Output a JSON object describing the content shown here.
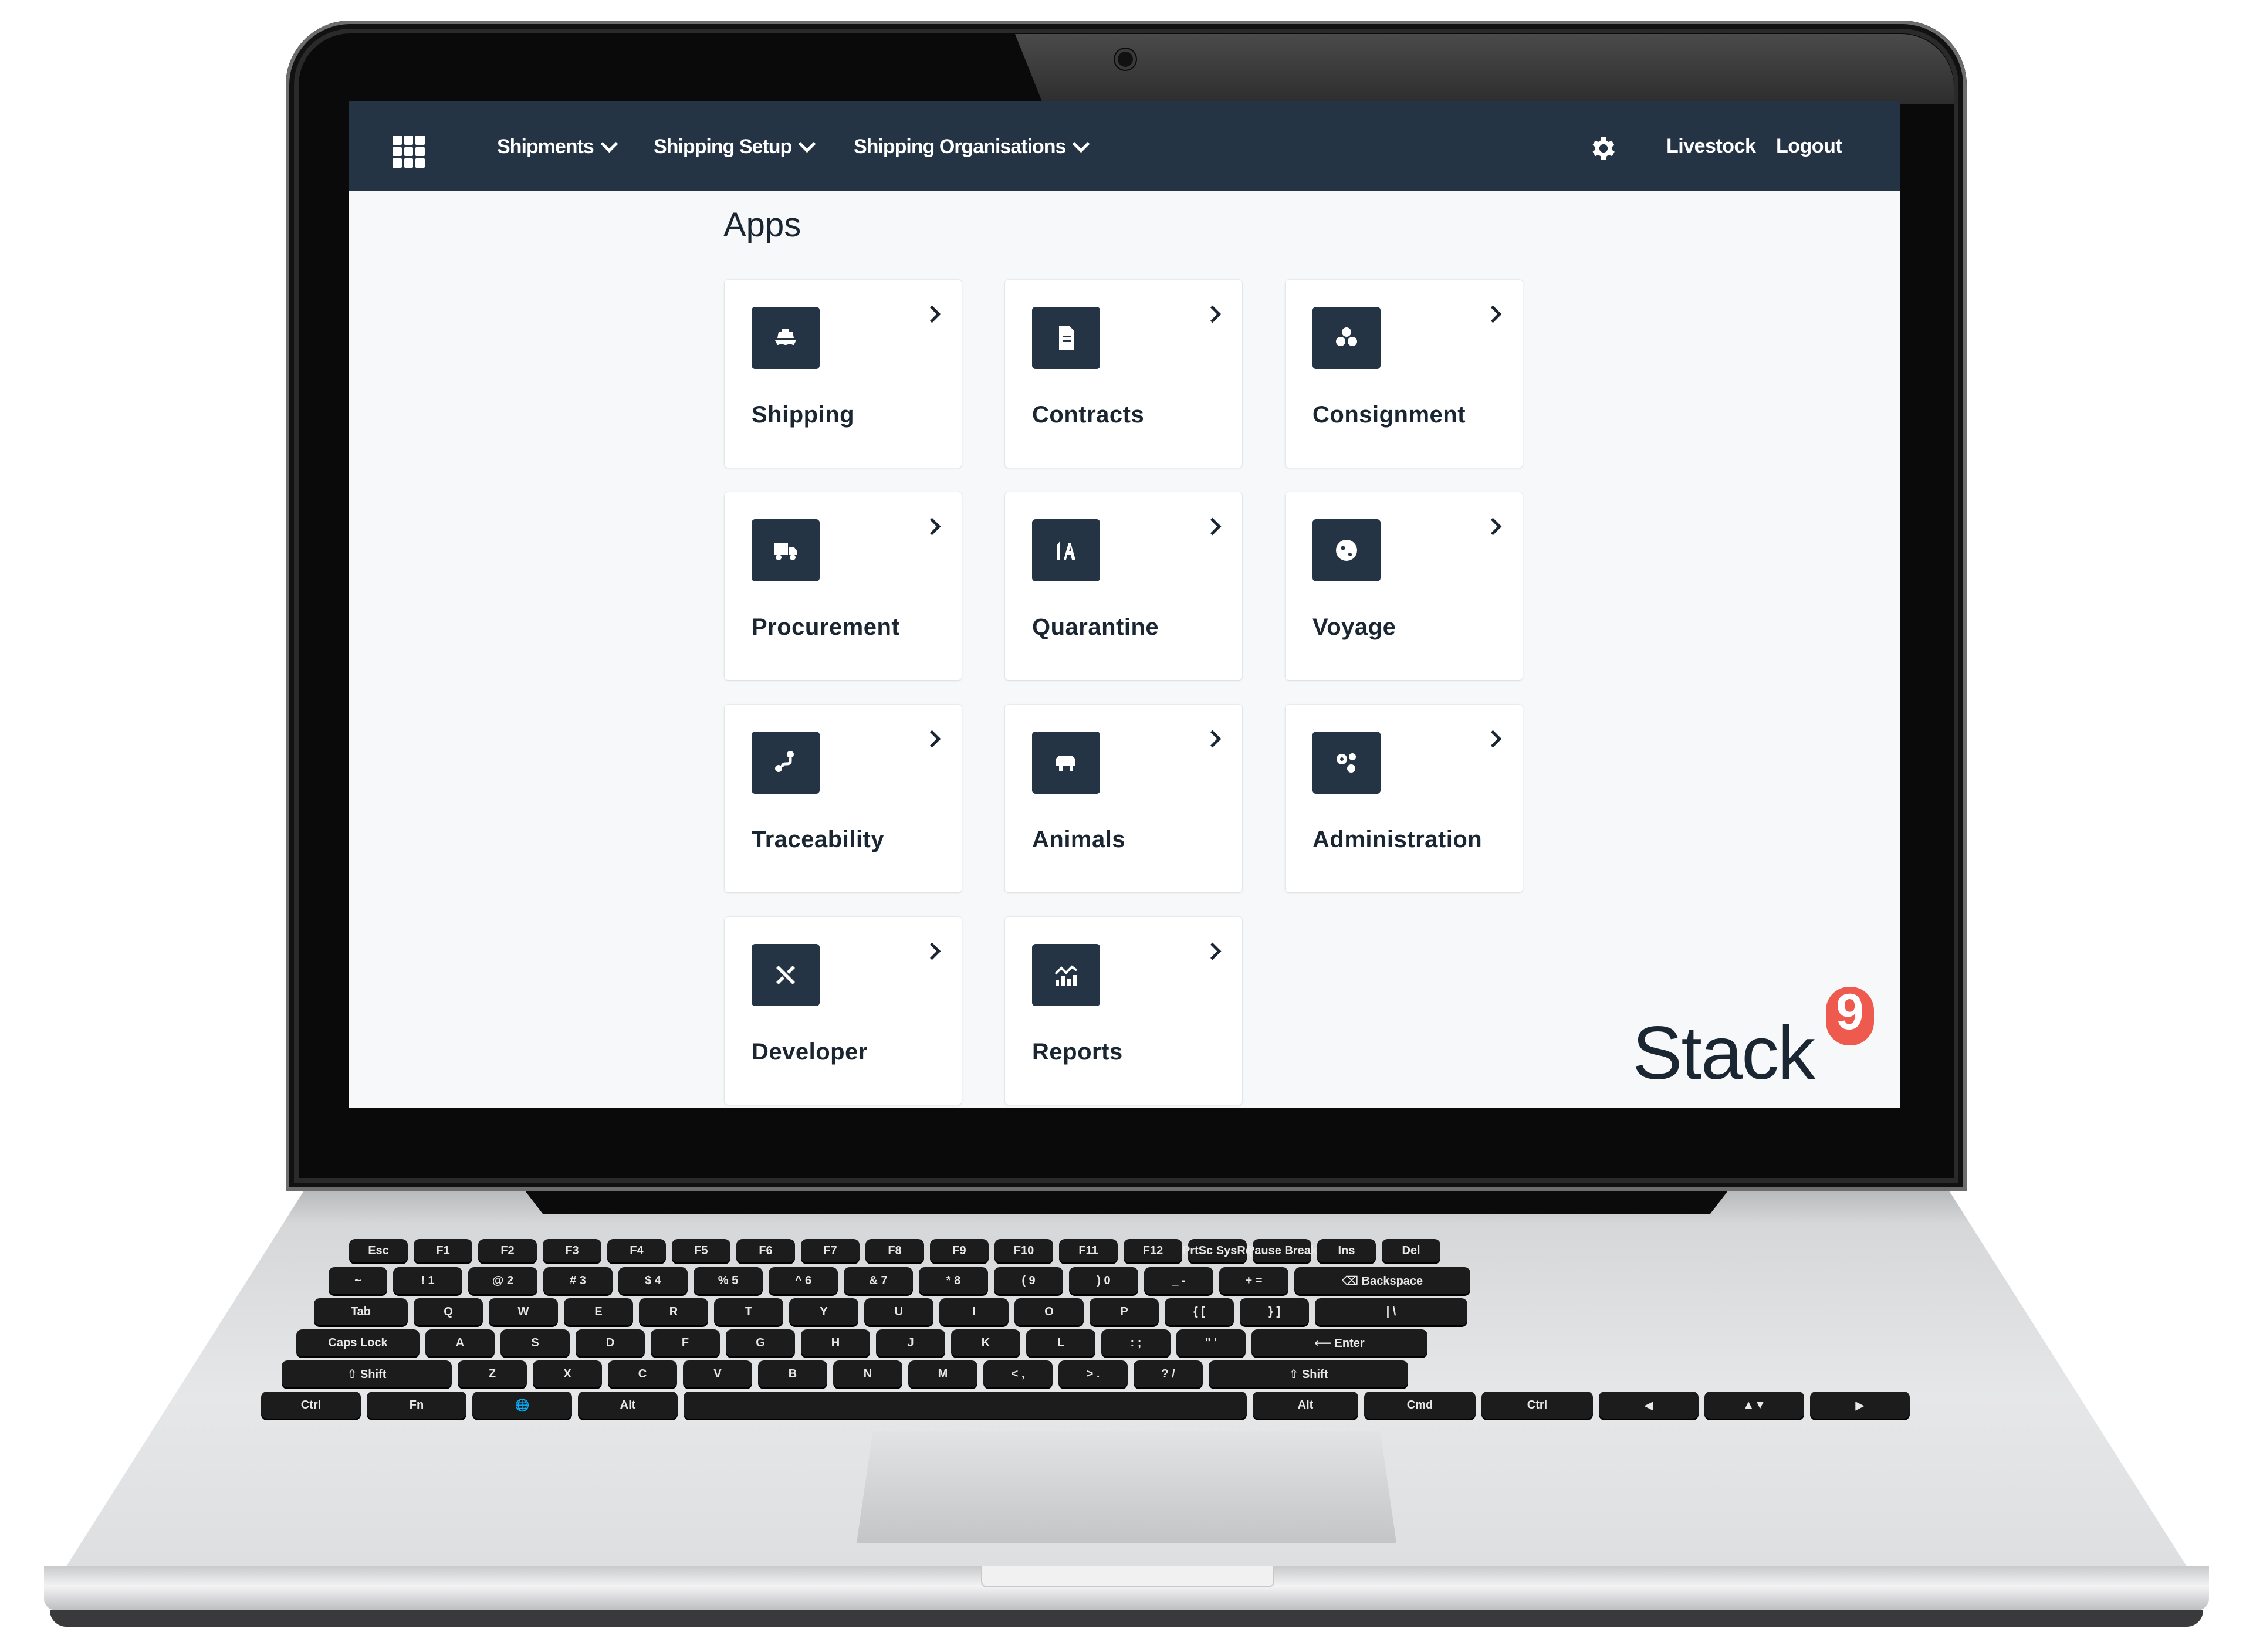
{
  "nav": {
    "apps_menu_icon": "grid-icon",
    "menus": [
      {
        "label": "Shipments",
        "icon": "chevron-down-icon"
      },
      {
        "label": "Shipping Setup",
        "icon": "chevron-down-icon"
      },
      {
        "label": "Shipping Organisations",
        "icon": "chevron-down-icon"
      }
    ],
    "settings_icon": "gear-icon",
    "links": [
      "Livestock",
      "Logout"
    ]
  },
  "page": {
    "title": "Apps"
  },
  "apps": [
    {
      "label": "Shipping",
      "icon": "ship-icon"
    },
    {
      "label": "Contracts",
      "icon": "document-icon"
    },
    {
      "label": "Consignment",
      "icon": "boxes-icon"
    },
    {
      "label": "Procurement",
      "icon": "truck-icon"
    },
    {
      "label": "Quarantine",
      "icon": "quarantine-icon"
    },
    {
      "label": "Voyage",
      "icon": "globe-icon"
    },
    {
      "label": "Traceability",
      "icon": "route-icon"
    },
    {
      "label": "Animals",
      "icon": "animal-icon"
    },
    {
      "label": "Administration",
      "icon": "cogs-icon"
    },
    {
      "label": "Developer",
      "icon": "tools-icon"
    },
    {
      "label": "Reports",
      "icon": "chart-icon"
    }
  ],
  "brand": {
    "name": "Stack",
    "badge": "9",
    "accent_color": "#ef5a4e",
    "nav_color": "#243444"
  },
  "keyboard": {
    "rows": [
      [
        "Esc",
        "F1",
        "F2",
        "F3",
        "F4",
        "F5",
        "F6",
        "F7",
        "F8",
        "F9",
        "F10",
        "F11",
        "F12",
        "PrtSc SysRq",
        "Pause Break",
        "Ins",
        "Del"
      ],
      [
        "~",
        "! 1",
        "@ 2",
        "# 3",
        "$ 4",
        "% 5",
        "^ 6",
        "& 7",
        "* 8",
        "( 9",
        ") 0",
        "_ -",
        "+ =",
        "⌫ Backspace"
      ],
      [
        "Tab",
        "Q",
        "W",
        "E",
        "R",
        "T",
        "Y",
        "U",
        "I",
        "O",
        "P",
        "{ [",
        "} ]",
        "| \\"
      ],
      [
        "Caps Lock",
        "A",
        "S",
        "D",
        "F",
        "G",
        "H",
        "J",
        "K",
        "L",
        ": ;",
        "\" '",
        "⟵ Enter"
      ],
      [
        "⇧ Shift",
        "Z",
        "X",
        "C",
        "V",
        "B",
        "N",
        "M",
        "< ,",
        "> .",
        "? /",
        "⇧ Shift"
      ],
      [
        "Ctrl",
        "Fn",
        "🌐",
        "Alt",
        "",
        "Alt",
        "Cmd",
        "Ctrl",
        "◀",
        "▲▼",
        "▶"
      ]
    ]
  }
}
